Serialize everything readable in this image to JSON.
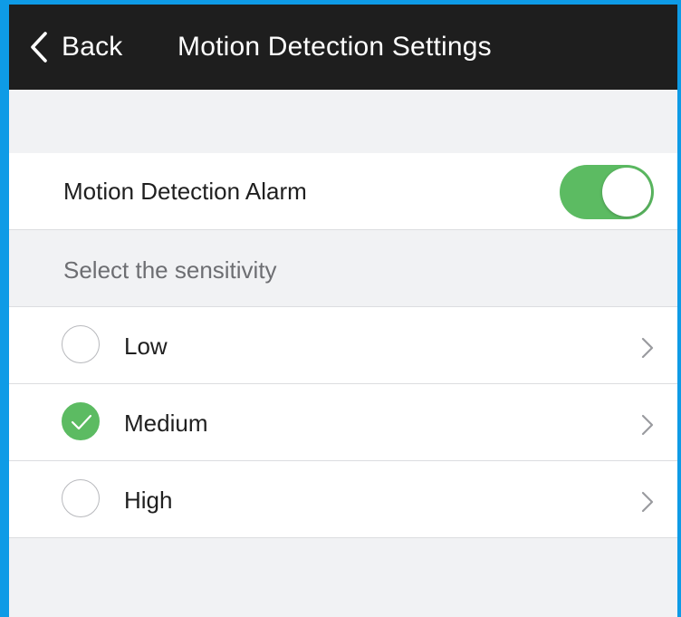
{
  "header": {
    "back_label": "Back",
    "title": "Motion Detection Settings",
    "back_icon": "chevron-left-icon",
    "background_color": "#1e1e1e"
  },
  "alarm": {
    "label": "Motion Detection Alarm",
    "enabled": true,
    "toggle_color": "#5cbb62"
  },
  "sensitivity": {
    "header": "Select the sensitivity",
    "options": [
      {
        "label": "Low",
        "selected": false
      },
      {
        "label": "Medium",
        "selected": true
      },
      {
        "label": "High",
        "selected": false
      }
    ],
    "selected_color": "#5cbb62",
    "row_icon": "chevron-right-icon"
  },
  "colors": {
    "page_background": "#f1f2f4",
    "outer_frame": "#0e9be6"
  }
}
